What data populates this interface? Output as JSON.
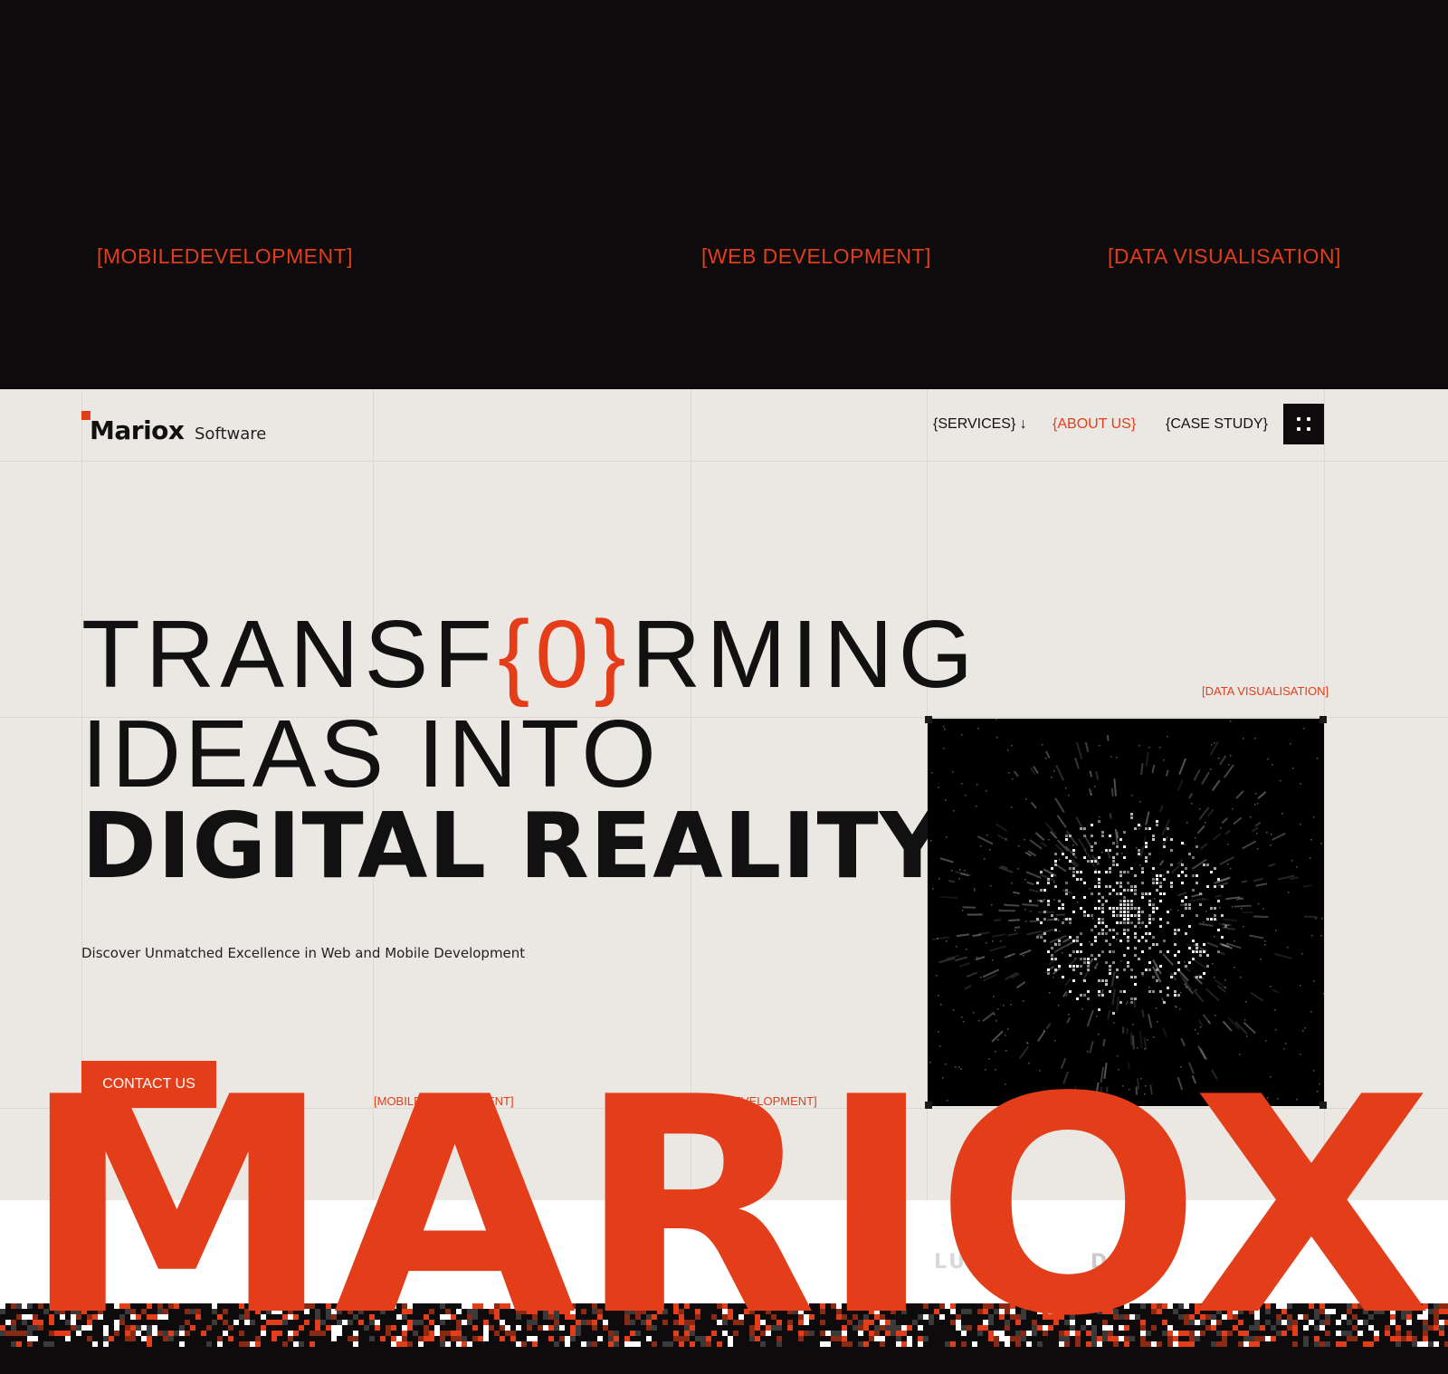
{
  "top_band": {
    "tags": [
      "[MOBILEDEVELOPMENT]",
      "[WEB DEVELOPMENT]",
      "[DATA VISUALISATION]"
    ]
  },
  "header": {
    "logo_name": "Mariox",
    "logo_sub": "Software",
    "nav": [
      {
        "label": "{SERVICES} ↓",
        "active": false
      },
      {
        "label": "{ABOUT US}",
        "active": true
      },
      {
        "label": "{CASE STUDY}",
        "active": false
      }
    ],
    "menu_icon": "grid-dots-icon"
  },
  "hero": {
    "line1_a": "TRANSF",
    "line1_bracket": "{0}",
    "line1_b": "RMING",
    "line2": "IDEAS INTO",
    "line3": "DIGITAL REALITY",
    "subline": "Discover Unmatched Excellence in Web and Mobile Development",
    "cta_label": "CONTACT US",
    "mini_tag_mobile": "[MOBILEDEVELOPMENT]",
    "mini_tag_web": "[WEB DEVELOPMENT]",
    "mini_tag_data": "[DATA VISUALISATION]"
  },
  "wordmark": "MARIOX",
  "clients": [
    "LUS",
    "DQ"
  ],
  "colors": {
    "accent": "#e33d1a",
    "dark": "#0d0b0c",
    "paper": "#ebe8e3",
    "ink": "#111111"
  }
}
